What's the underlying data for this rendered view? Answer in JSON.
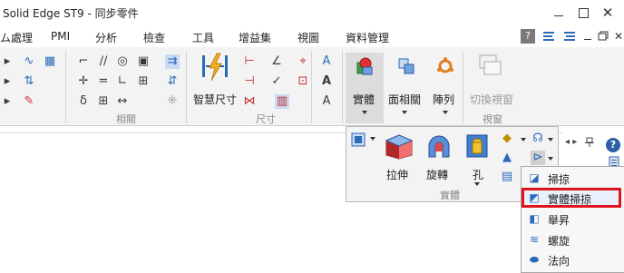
{
  "window": {
    "title": "Solid Edge ST9 - 同步零件",
    "controls": {
      "minimize": "—",
      "maximize": "☐",
      "close": "✕"
    }
  },
  "menu": {
    "tabs": [
      "ム處理",
      "PMI",
      "分析",
      "檢查",
      "工具",
      "增益集",
      "視圖",
      "資料管理"
    ]
  },
  "ribbon": {
    "groups": {
      "relations": "相關",
      "dimensions": "尺寸",
      "views": "視窗"
    },
    "smart_dimension": "智慧尺寸",
    "solid": "實體",
    "face_relate": "面相關",
    "pattern": "陣列",
    "switch_window": "切換視窗"
  },
  "solids_panel": {
    "extrude": "拉伸",
    "revolve": "旋轉",
    "hole": "孔",
    "group_label": "實體"
  },
  "sweep_menu": {
    "items": [
      "掃掠",
      "實體掃掠",
      "舉昇",
      "螺旋",
      "法向"
    ],
    "highlighted_index": 1,
    "highlight_color": "#e0141c"
  }
}
